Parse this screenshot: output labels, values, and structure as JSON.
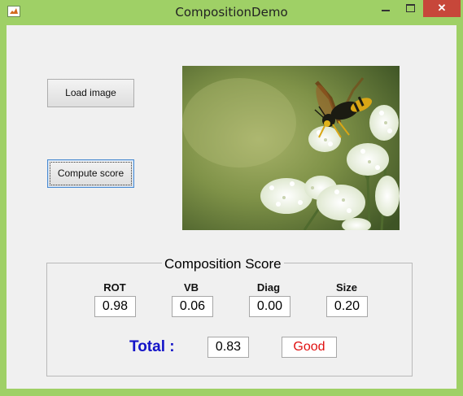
{
  "window": {
    "title": "CompositionDemo",
    "controls": {
      "minimize": "—",
      "maximize": "□",
      "close": "✕"
    }
  },
  "buttons": {
    "load": "Load image",
    "compute": "Compute score"
  },
  "image": {
    "icon": "photo-wasp-on-flowers"
  },
  "score_panel": {
    "title": "Composition Score",
    "metrics": [
      {
        "label": "ROT",
        "value": "0.98"
      },
      {
        "label": "VB",
        "value": "0.06"
      },
      {
        "label": "Diag",
        "value": "0.00"
      },
      {
        "label": "Size",
        "value": "0.20"
      }
    ],
    "total_label": "Total :",
    "total_value": "0.83",
    "rating": "Good"
  },
  "colors": {
    "frame": "#9fd066",
    "client": "#f0f0f0",
    "total_label": "#1414c8",
    "rating_text": "#e01010",
    "close_button": "#c7473a"
  }
}
